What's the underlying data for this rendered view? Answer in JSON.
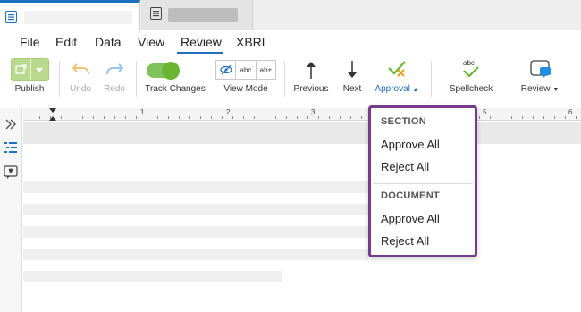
{
  "menu": {
    "file": "File",
    "edit": "Edit",
    "data": "Data",
    "view": "View",
    "review": "Review",
    "xbrl": "XBRL"
  },
  "ribbon": {
    "publish": "Publish",
    "undo": "Undo",
    "redo": "Redo",
    "track_changes": "Track Changes",
    "view_mode": "View Mode",
    "view_mode_options": [
      "abc",
      "ab±"
    ],
    "previous": "Previous",
    "next": "Next",
    "approval": "Approval",
    "spellcheck": "Spellcheck",
    "spellcheck_icon_text": "abc",
    "review": "Review"
  },
  "ruler": {
    "numbers": [
      "1",
      "2",
      "3",
      "5",
      "6"
    ]
  },
  "approval_menu": {
    "section_header": "SECTION",
    "section_approve": "Approve All",
    "section_reject": "Reject All",
    "document_header": "DOCUMENT",
    "document_approve": "Approve All",
    "document_reject": "Reject All"
  },
  "colors": {
    "accent": "#1f6fbf",
    "dropdown_border": "#7a3a8c",
    "toggle_on": "#6ab633"
  }
}
